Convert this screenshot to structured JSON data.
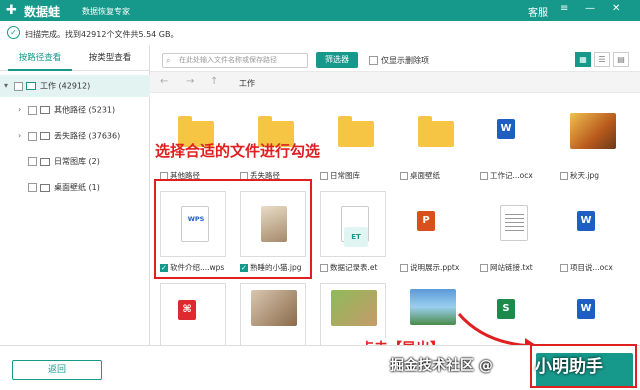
{
  "app": {
    "logo_icon": "plus-cross-icon",
    "name": "数据蛙",
    "slogan": "数据恢复专家",
    "menu_link": "客服"
  },
  "status": {
    "text": "扫描完成。找到42912个文件共5.54 GB。"
  },
  "sidebar": {
    "tabs": [
      "按路径查看",
      "按类型查看"
    ],
    "tree": [
      {
        "label": "工作 (42912)"
      },
      {
        "label": "其他路径 (5231)"
      },
      {
        "label": "丢失路径 (37636)"
      },
      {
        "label": "日常图库 (2)"
      },
      {
        "label": "桌面壁纸 (1)"
      }
    ]
  },
  "toolbar": {
    "search_placeholder": "在此处输入文件名称或保存路径",
    "filter_label": "筛选器",
    "show_deleted_label": "仅显示删除项"
  },
  "path": {
    "current": "工作"
  },
  "files": [
    {
      "name": "其他路径"
    },
    {
      "name": "丢失路径"
    },
    {
      "name": "日常图库"
    },
    {
      "name": "桌面壁纸"
    },
    {
      "name": "工作记...ocx"
    },
    {
      "name": "秋天.jpg"
    },
    {
      "name": "软件介绍....wps"
    },
    {
      "name": "熟睡的小猫.jpg"
    },
    {
      "name": "数据记录表.et"
    },
    {
      "name": "说明展示.pptx"
    },
    {
      "name": "网站链接.txt"
    },
    {
      "name": "项目说...ocx"
    }
  ],
  "badges": {
    "word": "W",
    "wps": "WPS",
    "et": "ET",
    "ppt": "P",
    "sheet": "S"
  },
  "annotations": {
    "select_hint": "选择合适的文件进行勾选",
    "click_hint": "点击【导出】"
  },
  "bottom": {
    "back_label": "返回"
  },
  "watermark": {
    "text": "掘金技术社区 @",
    "brand": "小明助手"
  },
  "colors": {
    "accent": "#16998b",
    "highlight": "#e02020"
  }
}
